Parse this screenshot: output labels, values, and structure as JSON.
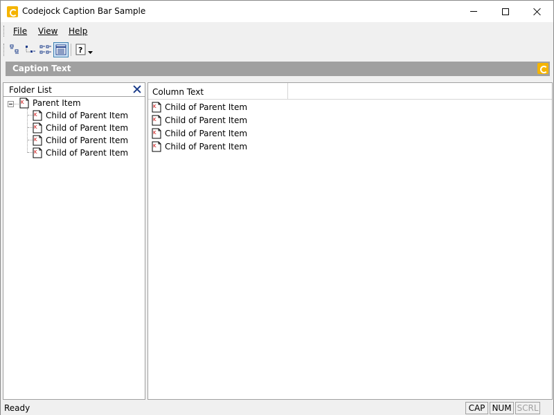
{
  "window": {
    "title": "Codejock Caption Bar Sample"
  },
  "menu": {
    "file": "File",
    "view": "View",
    "help": "Help"
  },
  "toolbar": {
    "buttons": [
      {
        "icon": "large-icons-view-icon"
      },
      {
        "icon": "small-icons-view-icon"
      },
      {
        "icon": "list-view-icon"
      },
      {
        "icon": "details-view-icon",
        "pressed": true
      },
      {
        "icon": "help-dropdown-icon"
      }
    ]
  },
  "caption_bar": {
    "text": "Caption Text"
  },
  "folder_pane": {
    "title": "Folder List",
    "tree": {
      "root": "Parent Item",
      "children": [
        "Child of Parent Item",
        "Child of Parent Item",
        "Child of Parent Item",
        "Child of Parent Item"
      ]
    }
  },
  "list_view": {
    "columns": [
      "Column Text"
    ],
    "rows": [
      "Child of Parent Item",
      "Child of Parent Item",
      "Child of Parent Item",
      "Child of Parent Item"
    ]
  },
  "status_bar": {
    "text": "Ready",
    "indicators": {
      "cap": "CAP",
      "num": "NUM",
      "scrl": "SCRL"
    }
  },
  "colors": {
    "caption_bar_bg": "#a0a0a0",
    "accent": "#f5b400",
    "selection_border": "#3c7fb1"
  }
}
